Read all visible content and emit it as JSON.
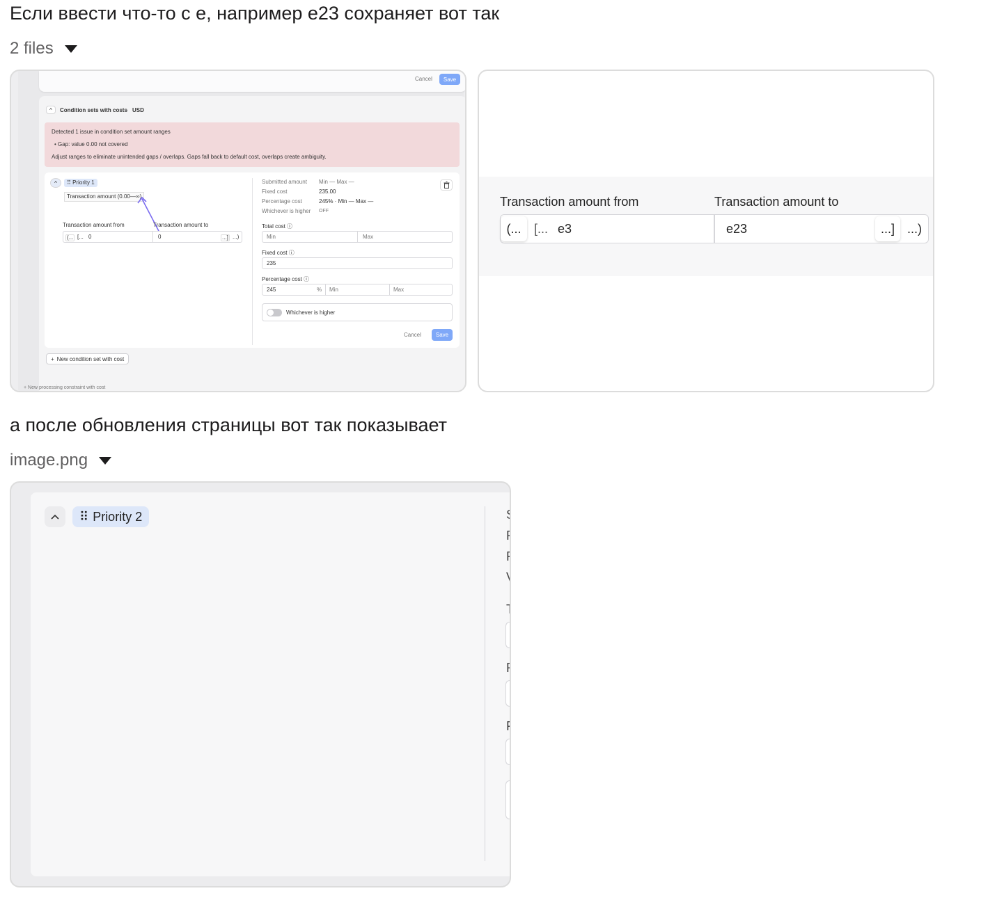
{
  "messages": [
    {
      "text": "Если ввести что-то с е, например е23 сохраняет вот так",
      "files_label": "2 files"
    },
    {
      "text": "а после обновления страницы  вот так показывает",
      "files_label": "image.png"
    }
  ],
  "thumb1": {
    "cancel_top": "Cancel",
    "save_top": "Save",
    "section_title": "Condition sets with costs",
    "section_dot": "·",
    "currency": "USD",
    "alert_title": "Detected 1 issue in condition set amount ranges",
    "alert_bullet": "Gap: value 0.00 not covered",
    "alert_hint": "Adjust ranges to eliminate unintended gaps / overlaps. Gaps fall back to default cost, overlaps create ambiguity.",
    "priority": "Priority 1",
    "range_label": "Transaction amount (0.00—∞)",
    "from_label": "Transaction amount from",
    "to_label": "Transaction amount to",
    "from_open": "(...",
    "from_bracket": "[...",
    "from_value": "0",
    "to_value": "0",
    "to_bracket": "...]",
    "to_close": "...)",
    "summary": {
      "submitted_label": "Submitted amount",
      "submitted_value": "Min  —   Max  —",
      "fixed_label": "Fixed cost",
      "fixed_value": "235.00",
      "percentage_label": "Percentage cost",
      "percentage_value": "245%  ·  Min  —   Max  —",
      "whichever_label": "Whichever is higher",
      "whichever_value": "OFF"
    },
    "total_cost_label": "Total cost",
    "total_min": "Min",
    "total_max": "Max",
    "fixed_cost_label": "Fixed cost",
    "fixed_cost_value": "235",
    "percentage_cost_label": "Percentage cost",
    "percentage_cost_value": "245",
    "percent_sign": "%",
    "percentage_min": "Min",
    "percentage_max": "Max",
    "whichever_toggle_label": "Whichever is higher",
    "cancel_bottom": "Cancel",
    "save_bottom": "Save",
    "new_condition_set": "New condition set with cost",
    "new_constraint": "New processing constraint with cost",
    "plus": "+"
  },
  "thumb2": {
    "from_label": "Transaction amount from",
    "to_label": "Transaction amount to",
    "from_open": "(...",
    "from_bracket": "[...",
    "from_value": "e3",
    "to_value": "e23",
    "to_bracket": "...]",
    "to_close": "...)"
  },
  "thumb3": {
    "priority": "Priority 2",
    "clipped_letters": [
      "S",
      "F",
      "F",
      "V",
      "T",
      "F",
      "F"
    ]
  },
  "colors": {
    "accent": "#7fa8f8",
    "alert_bg": "#f2d9db",
    "priority_badge": "#dde7f9",
    "arrow": "#7b6cf0"
  },
  "icons": [
    "caret-down-icon",
    "chevron-up-icon",
    "drag-handle-icon",
    "trash-icon",
    "info-icon",
    "plus-icon"
  ]
}
